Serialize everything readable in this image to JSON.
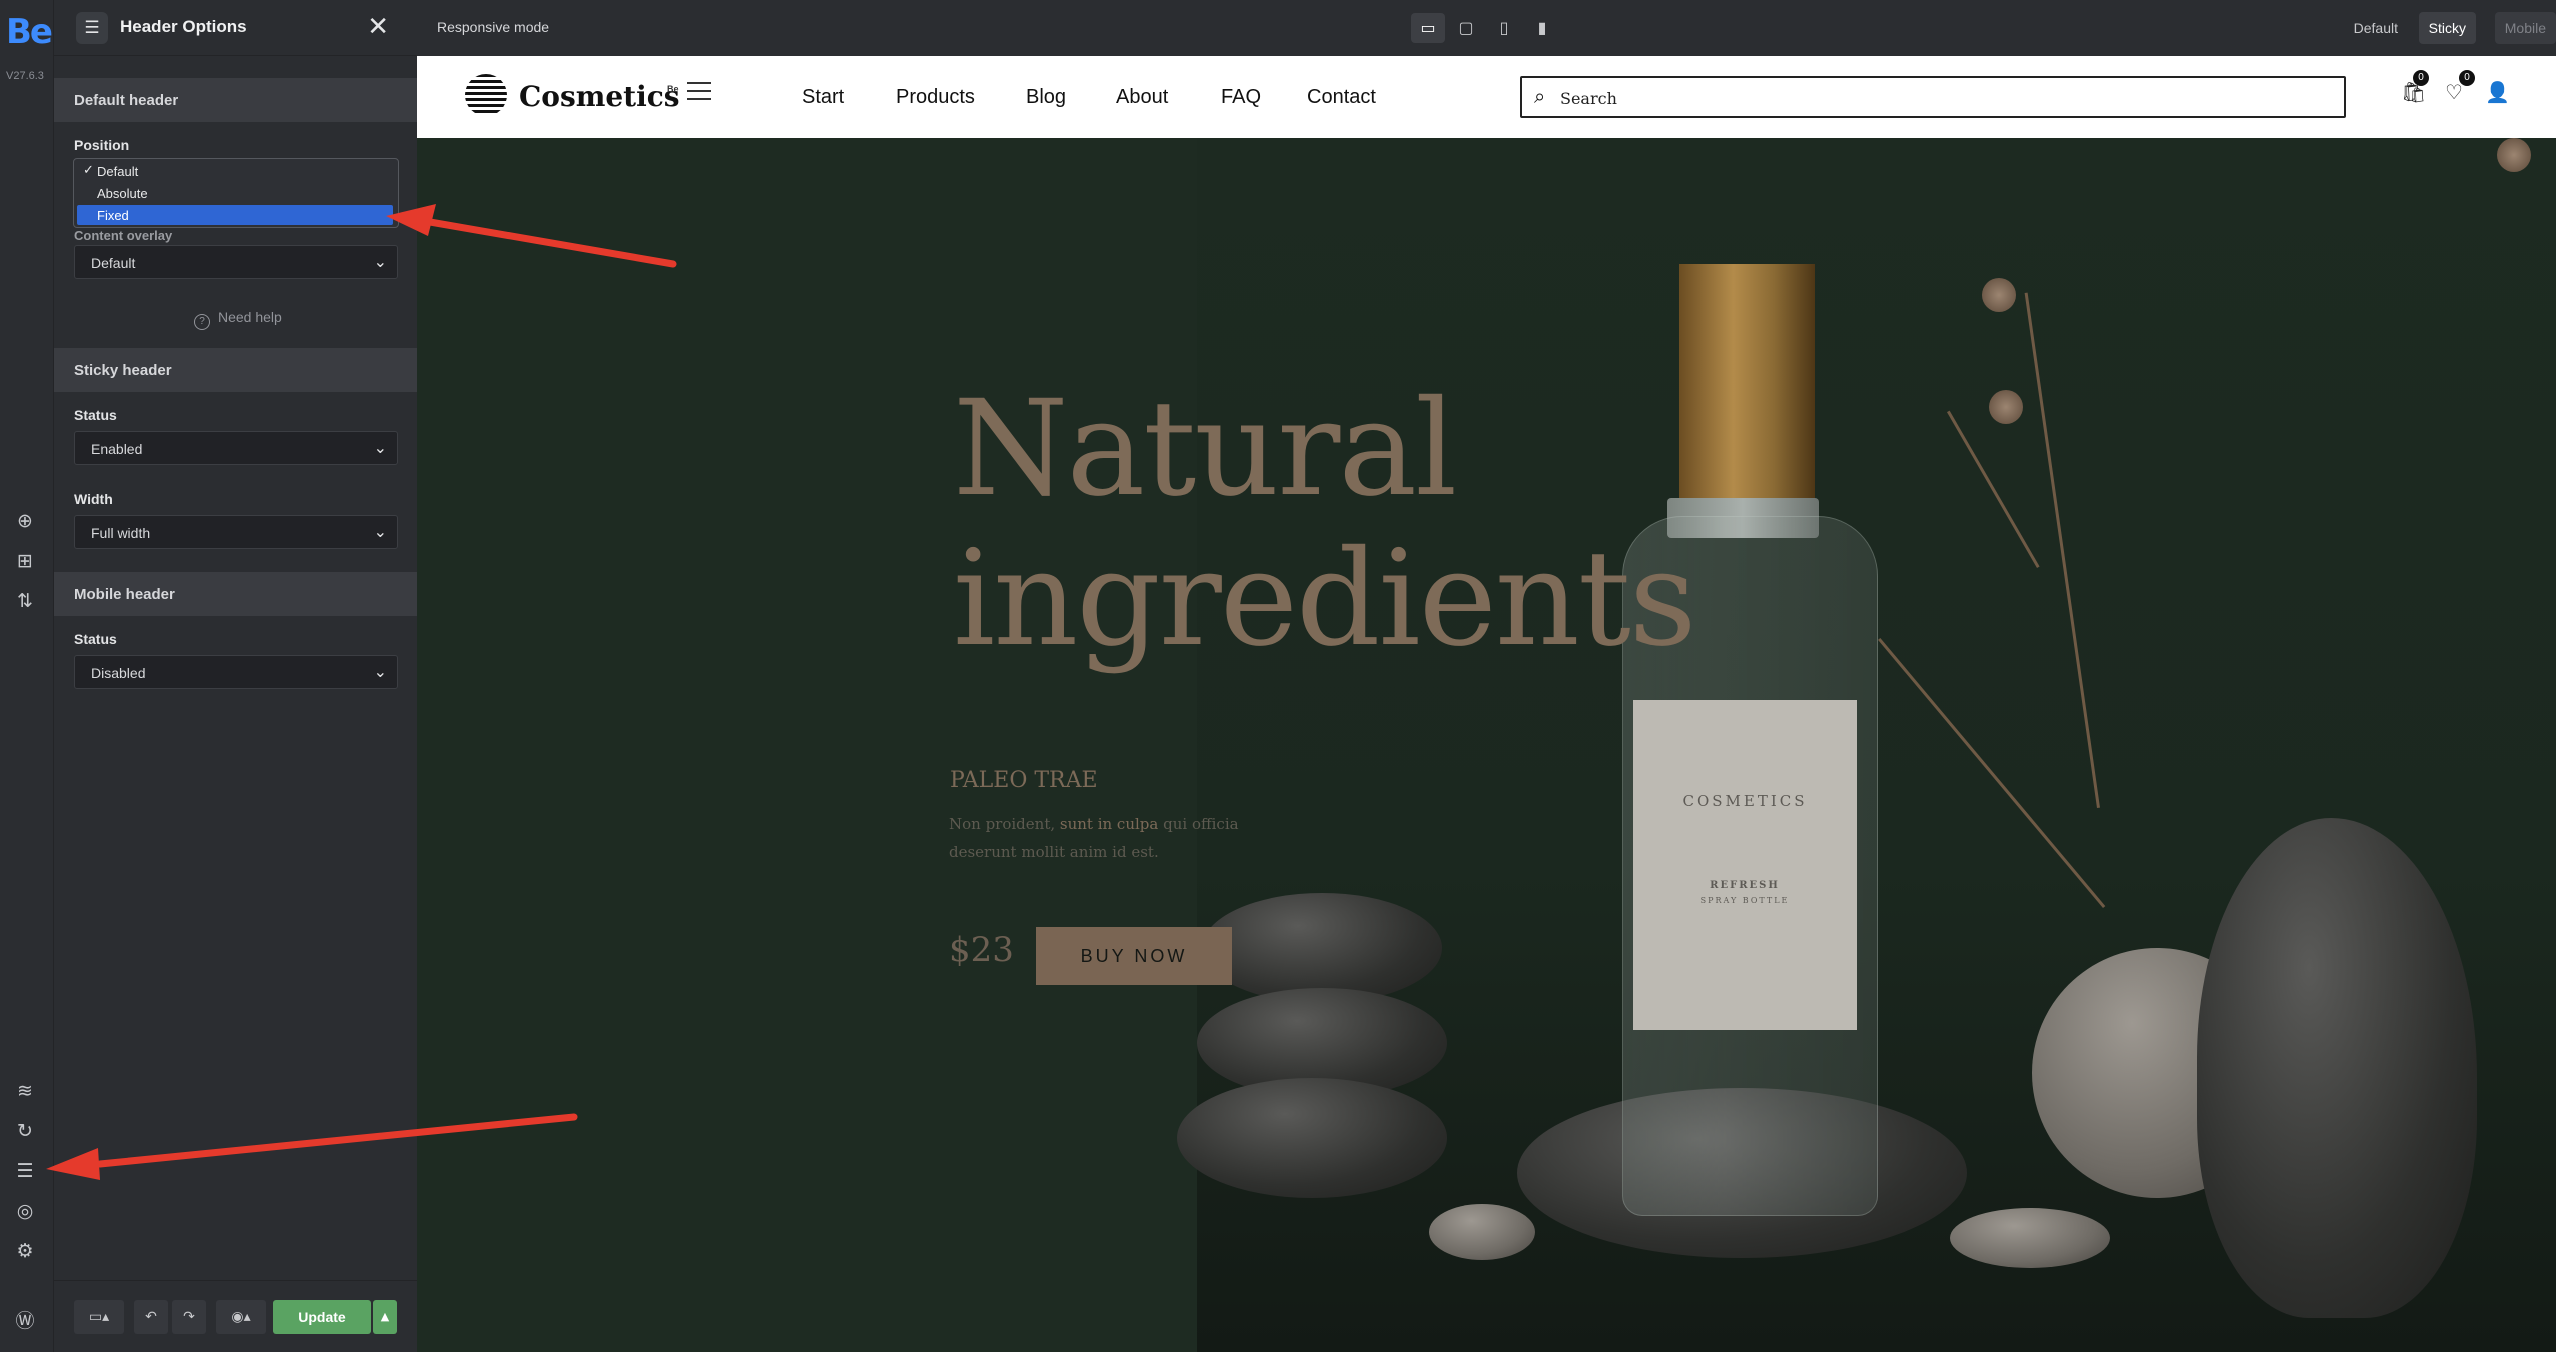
{
  "app": {
    "logo": "Be",
    "version": "V27.6.3"
  },
  "rail_icons": [
    "add-icon",
    "layout-icon",
    "sort-icon",
    "layers-icon",
    "history-icon",
    "sliders-icon",
    "globe-icon",
    "settings-icon",
    "wordpress-icon"
  ],
  "panel": {
    "title": "Header Options",
    "sections": {
      "default_header": {
        "title": "Default header",
        "position_label": "Position",
        "position_options": [
          "Default",
          "Absolute",
          "Fixed"
        ],
        "position_checked": "Default",
        "position_highlighted": "Fixed",
        "content_overlay_label": "Content overlay",
        "content_overlay_value": "Default",
        "help": "Need help"
      },
      "sticky_header": {
        "title": "Sticky header",
        "status_label": "Status",
        "status_value": "Enabled",
        "width_label": "Width",
        "width_value": "Full width"
      },
      "mobile_header": {
        "title": "Mobile header",
        "status_label": "Status",
        "status_value": "Disabled"
      }
    },
    "footer": {
      "update_label": "Update"
    }
  },
  "topbar": {
    "responsive_label": "Responsive mode",
    "devices": [
      "desktop-icon",
      "tablet-landscape-icon",
      "tablet-portrait-icon",
      "mobile-icon"
    ],
    "header_tabs": [
      "Default",
      "Sticky",
      "Mobile"
    ],
    "active_tab": "Sticky"
  },
  "site": {
    "brand": "Cosmetics",
    "brand_tag": "Be",
    "nav": [
      "Start",
      "Products",
      "Blog",
      "About",
      "FAQ",
      "Contact"
    ],
    "search_placeholder": "Search",
    "cart_count": "0",
    "wishlist_count": "0",
    "hero": {
      "title_line1": "Natural",
      "title_line2": "ingredients",
      "subhead": "PALEO TRAE",
      "desc_part1": "Non proident, ",
      "desc_bold": "sunt in culpa",
      "desc_part2": " qui officia deserunt mollit anim id est.",
      "price": "$23",
      "cta": "BUY NOW",
      "bottle_brand": "COSMETICS",
      "bottle_line1": "REFRESH",
      "bottle_line2": "SPRAY BOTTLE"
    }
  }
}
